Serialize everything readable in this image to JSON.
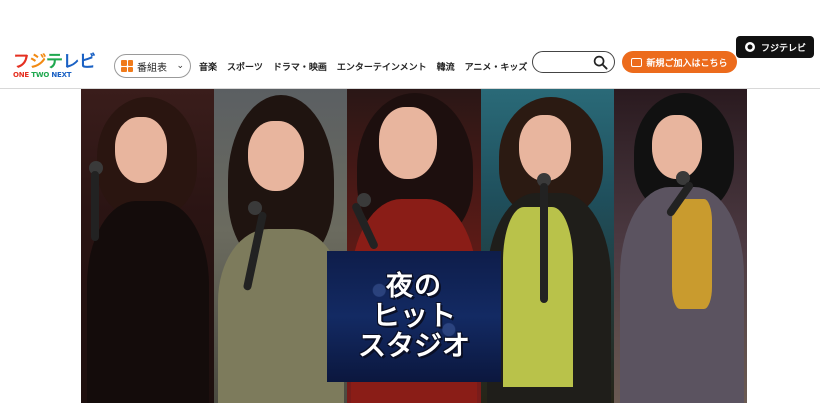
{
  "corner_badge": {
    "label": "フジテレビ",
    "icon": "eye-icon"
  },
  "logo": {
    "main": [
      "フ",
      "ジ",
      "テ",
      "レビ"
    ],
    "sub": [
      "ONE",
      "TWO",
      "NEXT"
    ]
  },
  "program_guide": {
    "label": "番組表",
    "icon": "grid-icon"
  },
  "nav": {
    "items": [
      "音楽",
      "スポーツ",
      "ドラマ・映画",
      "エンターテインメント",
      "韓流",
      "アニメ・キッズ"
    ]
  },
  "search": {
    "placeholder": "",
    "icon": "search-icon"
  },
  "join_button": {
    "label": "新規ご加入はこちら",
    "icon": "tv-icon"
  },
  "hero": {
    "title_lines": [
      "夜の",
      "ヒット",
      "スタジオ"
    ]
  },
  "colors": {
    "accent_orange": "#ec6b1c",
    "hero_title_bg": "#132a63"
  }
}
